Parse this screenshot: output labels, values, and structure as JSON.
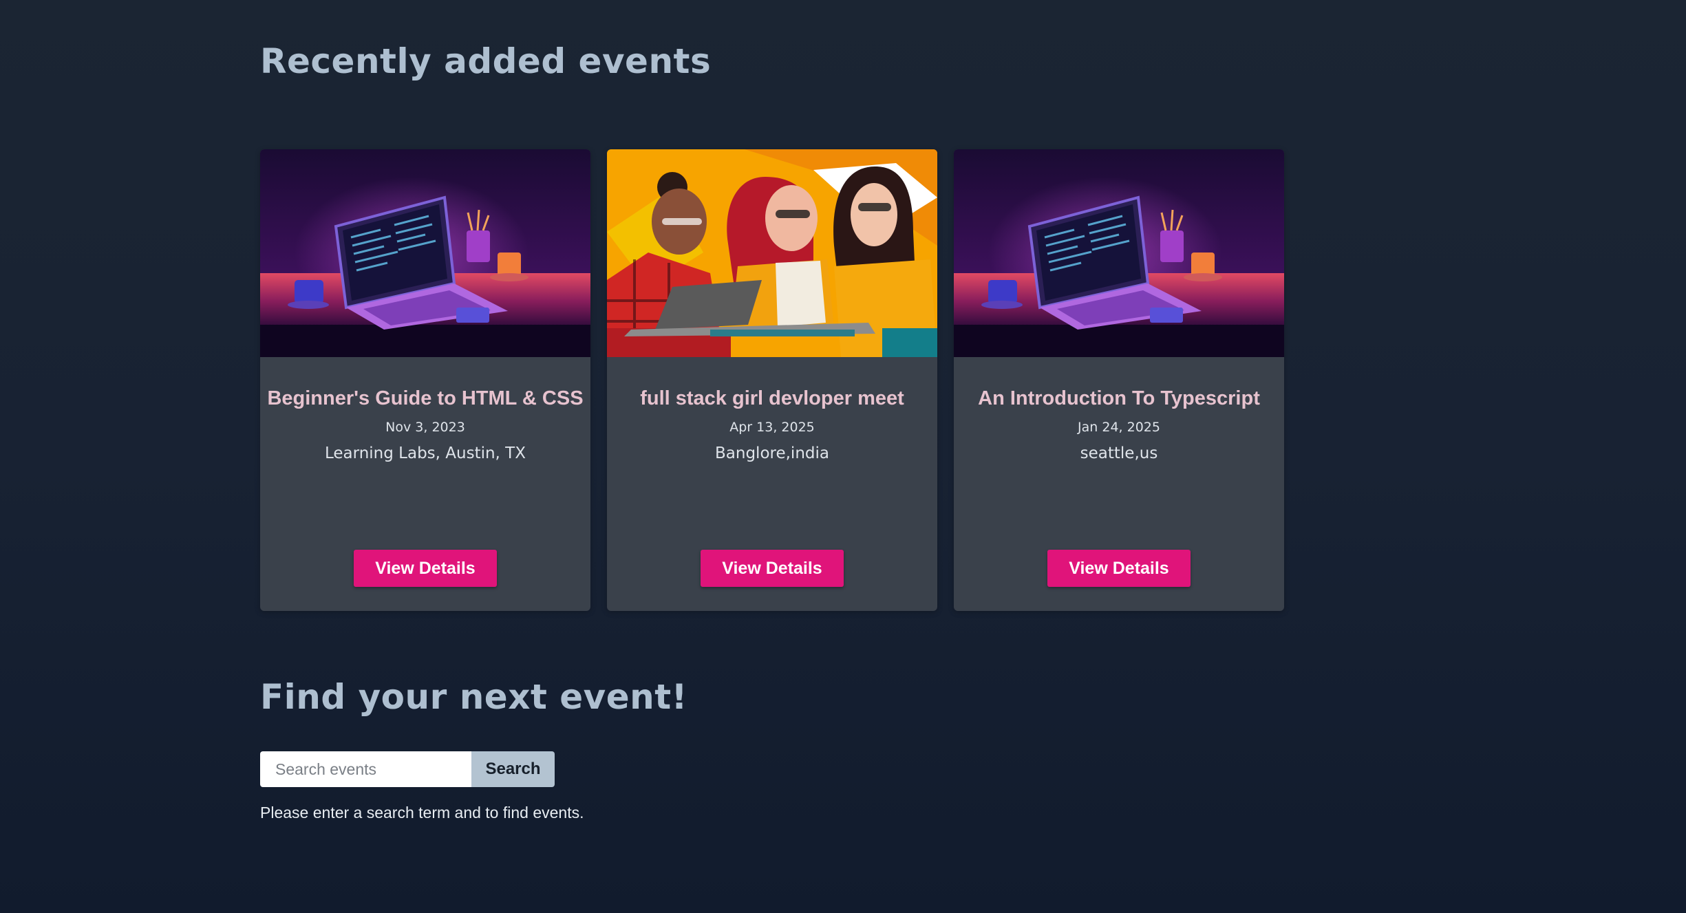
{
  "sections": {
    "recent_title": "Recently added events",
    "find_title": "Find your next event!"
  },
  "events": [
    {
      "title": "Beginner's Guide to HTML & CSS",
      "date": "Nov 3, 2023",
      "location": "Learning Labs, Austin, TX",
      "button_label": "View Details",
      "image": "laptop-desk-illustration"
    },
    {
      "title": "full stack girl devloper meet",
      "date": "Apr 13, 2025",
      "location": "Banglore,india",
      "button_label": "View Details",
      "image": "three-women-laptops-illustration"
    },
    {
      "title": "An Introduction To Typescript",
      "date": "Jan 24, 2025",
      "location": "seattle,us",
      "button_label": "View Details",
      "image": "laptop-desk-illustration"
    }
  ],
  "search": {
    "placeholder": "Search events",
    "value": "",
    "button_label": "Search",
    "hint": "Please enter a search term and to find events."
  },
  "colors": {
    "background": "#1b2533",
    "card": "#3a414b",
    "accent": "#e0147a",
    "heading": "#aebfd0",
    "card_title": "#e7c3cf",
    "search_button": "#b3c3d1"
  }
}
